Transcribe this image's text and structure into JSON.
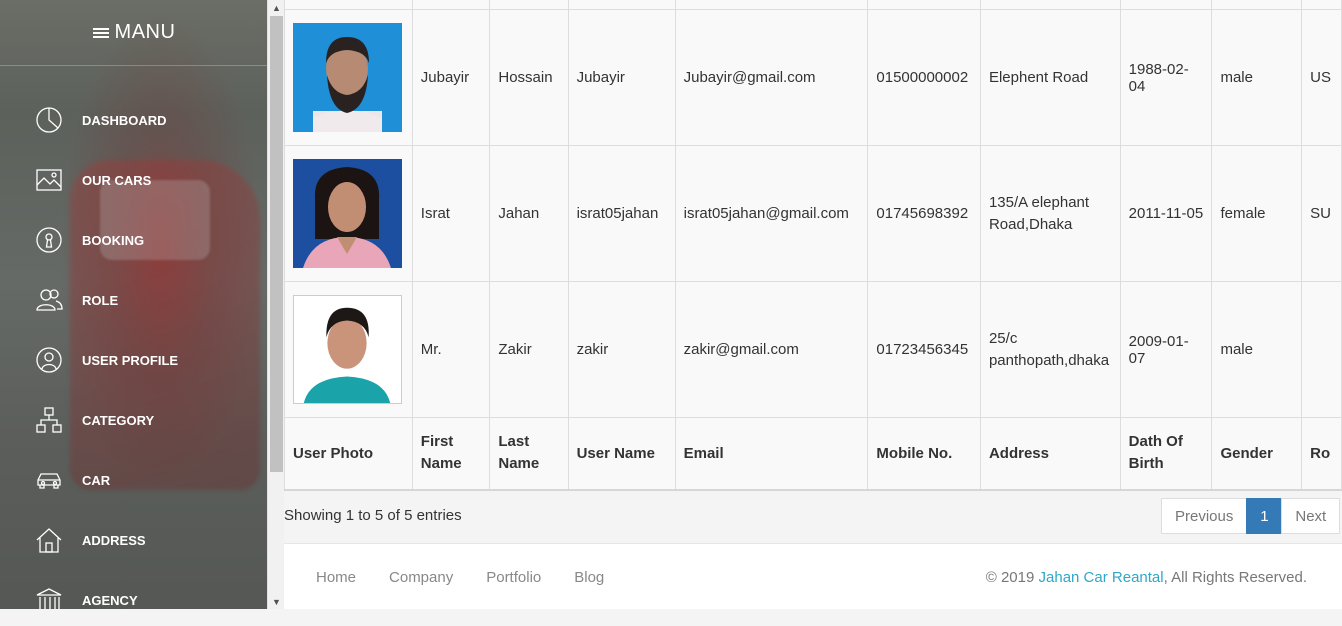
{
  "sidebar": {
    "title": "MANU",
    "items": [
      {
        "label": "DASHBOARD",
        "icon": "pie-chart-icon"
      },
      {
        "label": "OUR CARS",
        "icon": "image-icon"
      },
      {
        "label": "BOOKING",
        "icon": "keyhole-icon"
      },
      {
        "label": "ROLE",
        "icon": "users-icon"
      },
      {
        "label": "USER PROFILE",
        "icon": "user-circle-icon"
      },
      {
        "label": "CATEGORY",
        "icon": "hierarchy-icon"
      },
      {
        "label": "CAR",
        "icon": "car-icon"
      },
      {
        "label": "ADDRESS",
        "icon": "home-icon"
      },
      {
        "label": "AGENCY",
        "icon": "bank-icon"
      }
    ]
  },
  "table": {
    "headers": [
      "User Photo",
      "First Name",
      "Last Name",
      "User Name",
      "Email",
      "Mobile No.",
      "Address",
      "Dath Of Birth",
      "Gender",
      "Ro"
    ],
    "rows": [
      {
        "first": "Jubayir",
        "last": "Hossain",
        "username": "Jubayir",
        "email": "Jubayir@gmail.com",
        "mobile": "01500000002",
        "address": "Elephent Road",
        "dob": "1988-02-04",
        "gender": "male",
        "role": "US"
      },
      {
        "first": "Israt",
        "last": "Jahan",
        "username": "israt05jahan",
        "email": "israt05jahan@gmail.com",
        "mobile": "01745698392",
        "address": "135/A elephant Road,Dhaka",
        "dob": "2011-11-05",
        "gender": "female",
        "role": "SU"
      },
      {
        "first": "Mr.",
        "last": "Zakir",
        "username": "zakir",
        "email": "zakir@gmail.com",
        "mobile": "01723456345",
        "address": "25/c panthopath,dhaka",
        "dob": "2009-01-07",
        "gender": "male",
        "role": ""
      }
    ]
  },
  "pagination": {
    "info": "Showing 1 to 5 of 5 entries",
    "previous": "Previous",
    "page": "1",
    "next": "Next"
  },
  "footer": {
    "links": [
      "Home",
      "Company",
      "Portfolio",
      "Blog"
    ],
    "copyright_prefix": "© 2019 ",
    "brand": "Jahan Car Reantal",
    "copyright_suffix": ", All Rights Reserved."
  },
  "colors": {
    "accent": "#337ab7",
    "brand_link": "#2fa8c8"
  }
}
